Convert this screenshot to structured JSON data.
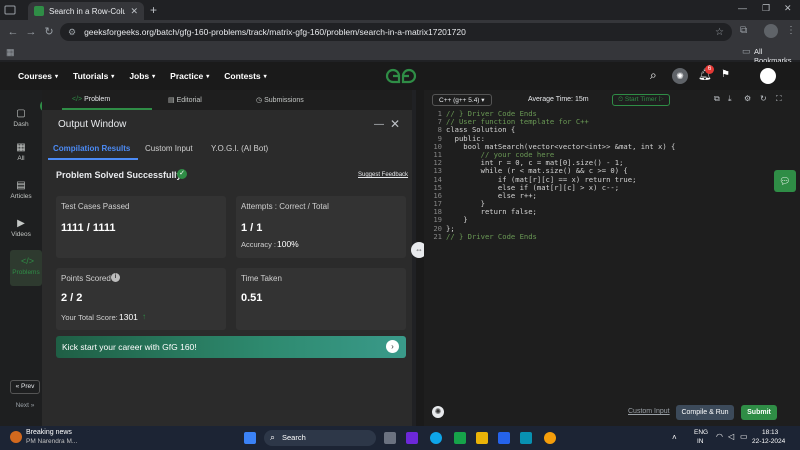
{
  "browser": {
    "tab_title": "Search in a Row-Column sorted",
    "url": "geeksforgeeks.org/batch/gfg-160-problems/track/matrix-gfg-160/problem/search-in-a-matrix17201720",
    "bookmarks_label": "All Bookmarks"
  },
  "header": {
    "menus": [
      "Courses",
      "Tutorials",
      "Jobs",
      "Practice",
      "Contests"
    ],
    "notification_count": "6"
  },
  "rail": {
    "items": [
      "Dash",
      "All",
      "Articles",
      "Videos",
      "Problems"
    ],
    "prev": "Prev",
    "next": "Next"
  },
  "problem_tabs": [
    "Problem",
    "Editorial",
    "Submissions"
  ],
  "output_window": {
    "title": "Output Window",
    "tabs": [
      "Compilation Results",
      "Custom Input",
      "Y.O.G.I. (AI Bot)"
    ],
    "status": "Problem Solved Successfully",
    "suggest_feedback": "Suggest Feedback",
    "test_cases_label": "Test Cases Passed",
    "test_cases_value": "1111 / 1111",
    "attempts_label": "Attempts : Correct / Total",
    "attempts_value": "1 / 1",
    "accuracy_label": "Accuracy :",
    "accuracy_value": "100%",
    "points_label": "Points Scored",
    "points_value": "2 / 2",
    "total_score_label": "Your Total Score:",
    "total_score_value": "1301",
    "time_label": "Time Taken",
    "time_value": "0.51",
    "banner": "Kick start your career with GfG 160!"
  },
  "editor": {
    "language": "C++ (g++ 5.4)",
    "average_time": "Average Time: 15m",
    "start_timer": "Start Timer",
    "lines": [
      {
        "n": "1",
        "t": "// } Driver Code Ends"
      },
      {
        "n": "7",
        "t": "// User function template for C++"
      },
      {
        "n": "8",
        "t": "class Solution {"
      },
      {
        "n": "9",
        "t": "  public:"
      },
      {
        "n": "10",
        "t": "    bool matSearch(vector<vector<int>> &mat, int x) {"
      },
      {
        "n": "11",
        "t": "        // your code here"
      },
      {
        "n": "12",
        "t": "        int r = 0, c = mat[0].size() - 1;"
      },
      {
        "n": "13",
        "t": "        while (r < mat.size() && c >= 0) {"
      },
      {
        "n": "14",
        "t": "            if (mat[r][c] == x) return true;"
      },
      {
        "n": "15",
        "t": "            else if (mat[r][c] > x) c--;"
      },
      {
        "n": "16",
        "t": "            else r++;"
      },
      {
        "n": "17",
        "t": "        }"
      },
      {
        "n": "18",
        "t": "        return false;"
      },
      {
        "n": "19",
        "t": "    }"
      },
      {
        "n": "20",
        "t": "};"
      },
      {
        "n": "21",
        "t": "// } Driver Code Ends"
      }
    ],
    "custom_input": "Custom Input",
    "compile_run": "Compile & Run",
    "submit": "Submit"
  },
  "taskbar": {
    "news_title": "Breaking news",
    "news_sub": "PM Narendra M...",
    "search": "Search",
    "lang1": "ENG",
    "lang2": "IN",
    "time": "18:13",
    "date": "22-12-2024"
  },
  "colors": {
    "gfg_green": "#2f8d46",
    "accent_blue": "#4c8bf5",
    "submit_green": "#2f8d46"
  }
}
